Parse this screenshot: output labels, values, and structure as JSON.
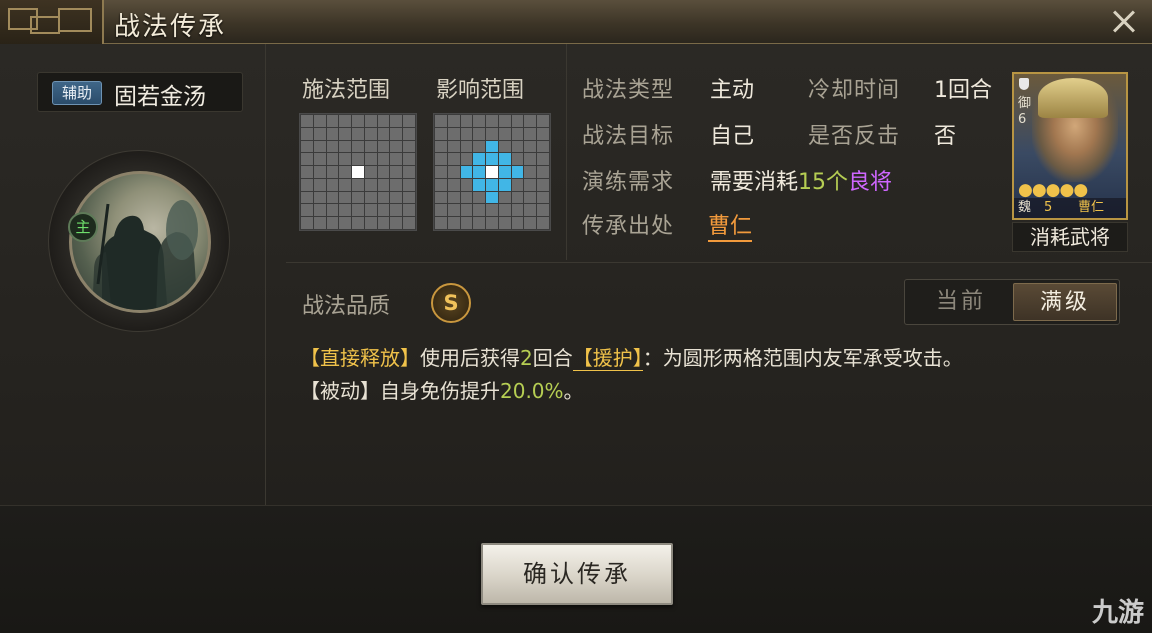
{
  "dialog": {
    "title": "战法传承"
  },
  "skill": {
    "type_badge": "辅助",
    "name": "固若金汤",
    "portrait_badge": "主"
  },
  "range": {
    "cast_label": "施法范围",
    "effect_label": "影响范围"
  },
  "info": {
    "type_label": "战法类型",
    "type_value": "主动",
    "cooldown_label": "冷却时间",
    "cooldown_value": "1回合",
    "target_label": "战法目标",
    "target_value": "自己",
    "counter_label": "是否反击",
    "counter_value": "否",
    "train_label": "演练需求",
    "train_prefix": "需要消耗",
    "train_count": "15个",
    "train_grade": "良将",
    "source_label": "传承出处",
    "source_value": "曹仁"
  },
  "general_card": {
    "faction": "魏",
    "cost": "5",
    "name": "曹仁",
    "troop_type": "御",
    "troop_level": "6",
    "stars": "●●●●●",
    "caption": "消耗武将"
  },
  "quality": {
    "label": "战法品质",
    "grade": "S"
  },
  "level_toggle": {
    "current_label": "当前",
    "max_label": "满级",
    "selected": "满级"
  },
  "description": {
    "line1_tag": "【直接释放】",
    "line1_part1": "使用后获得",
    "line1_num": "2",
    "line1_part2": "回合",
    "line1_keyword": "【援护】",
    "line1_part3": "：为圆形两格范围内友军承受攻击。",
    "line2_tag": "【被动】",
    "line2_part1": "自身免伤提升",
    "line2_num": "20.0%",
    "line2_part2": "。"
  },
  "footer": {
    "confirm_label": "确认传承"
  },
  "watermark": {
    "text": "九游"
  },
  "colors": {
    "highlight_green": "#b6ce53",
    "highlight_purple": "#cf66ff",
    "source_orange": "#f29a3c",
    "area_blue": "#41b6e6",
    "gold": "#f0c24a"
  }
}
